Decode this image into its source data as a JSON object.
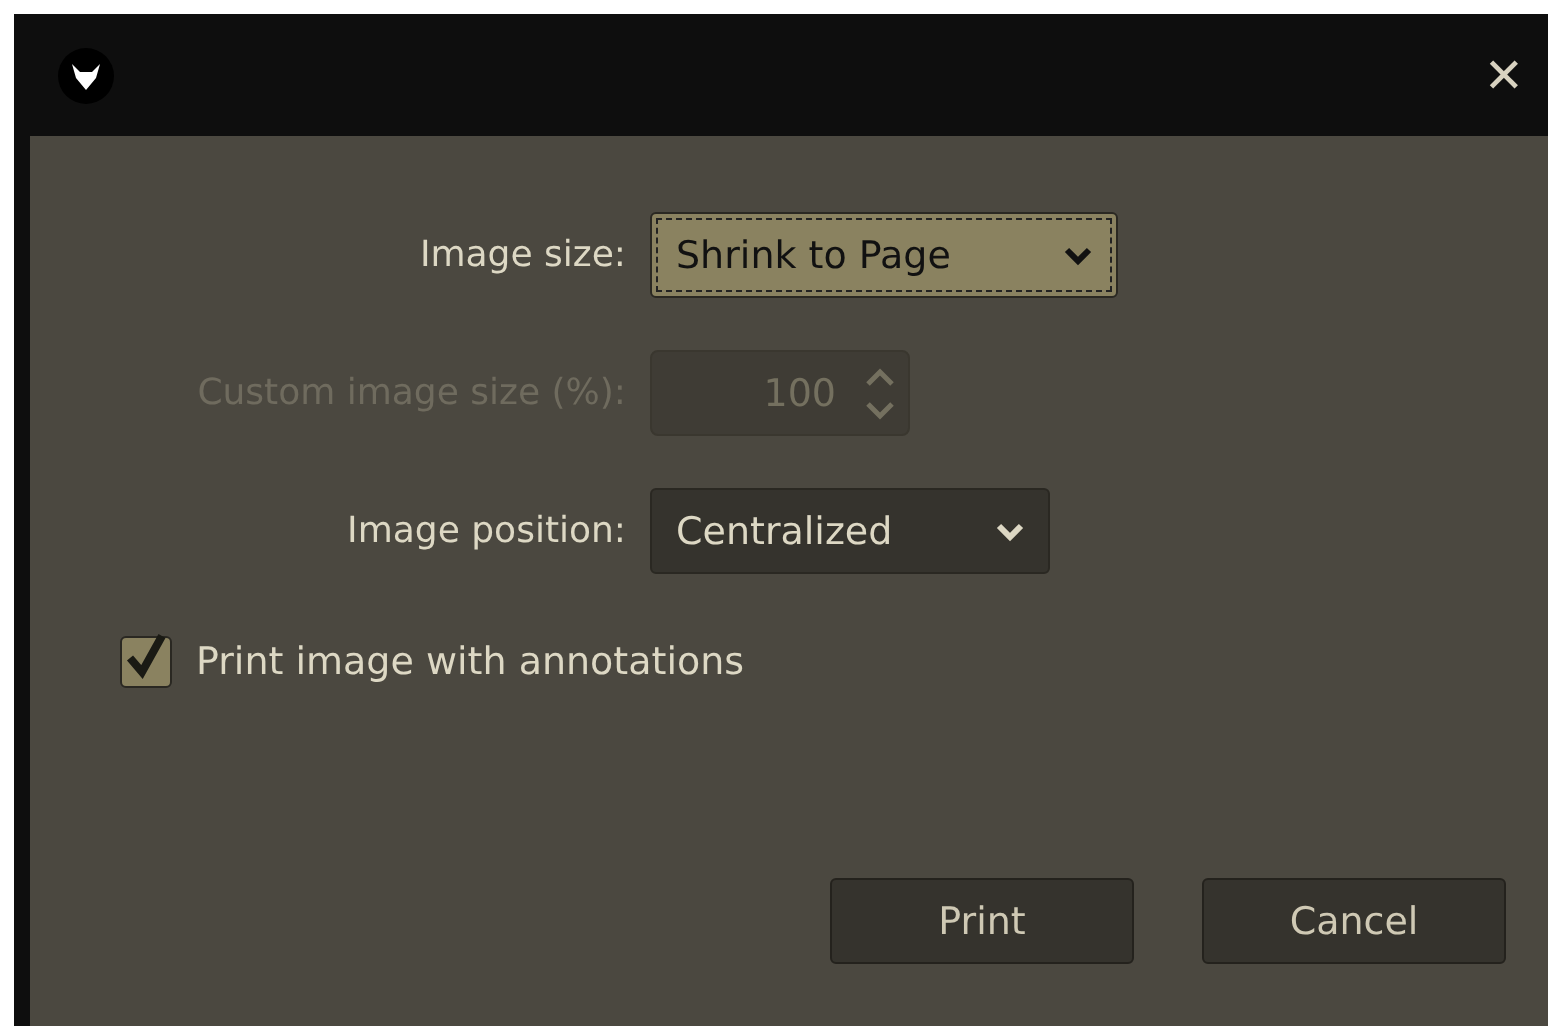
{
  "title_bar": {
    "close": "✕"
  },
  "fields": [
    {
      "kind": "select",
      "label": "Image size:",
      "value": "Shrink to Page",
      "focused": true,
      "disabled": false
    },
    {
      "kind": "spin",
      "label": "Custom image size (%):",
      "value": "100",
      "disabled": true
    },
    {
      "kind": "select",
      "label": "Image position:",
      "value": "Centralized",
      "focused": false,
      "disabled": false
    }
  ],
  "checkbox": {
    "label": "Print image with annotations",
    "checked": true
  },
  "buttons": [
    "Print",
    "Cancel"
  ]
}
